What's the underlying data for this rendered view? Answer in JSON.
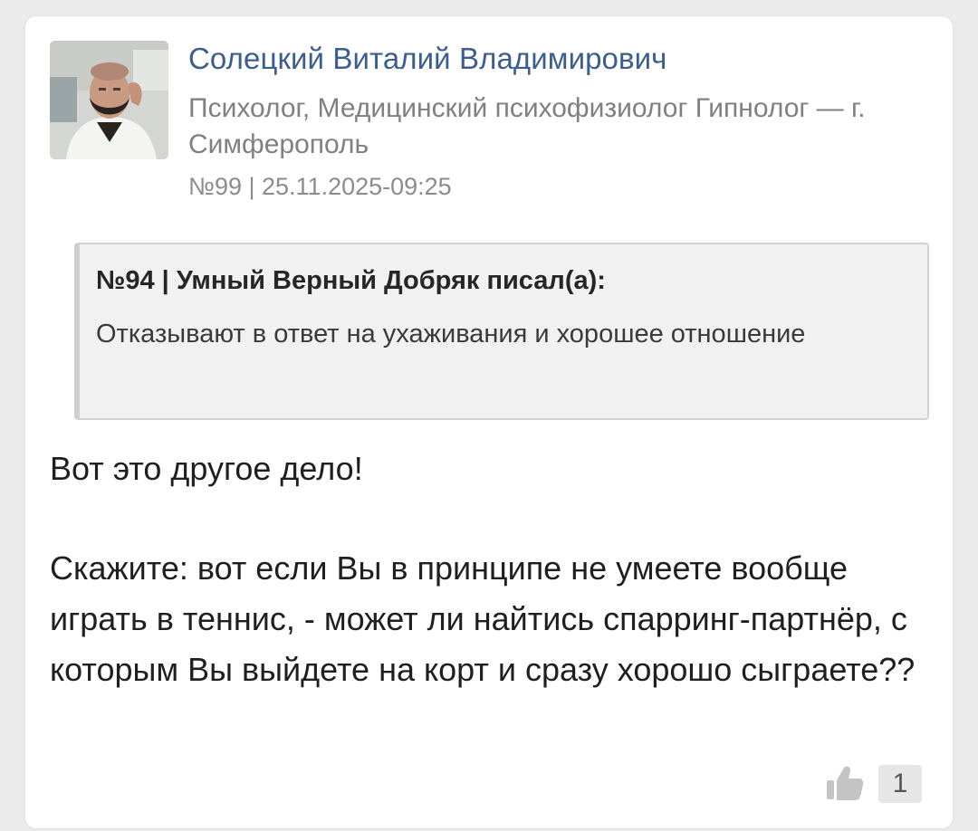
{
  "author": {
    "name": "Солецкий Виталий Владимирович",
    "title": "Психолог, Медицинский психофизиолог Гипнолог — г. Симферополь",
    "post_meta": "№99 | 25.11.2025-09:25"
  },
  "quote": {
    "header": "№94 | Умный Верный Добряк писал(а):",
    "text": "Отказывают в ответ на ухаживания и хорошее отношение"
  },
  "post": {
    "paragraph1": "Вот это другое дело!",
    "paragraph2": "Скажите: вот если Вы в принципе не умеете вообще играть в теннис, - может ли найтись спарринг-партнёр, с которым Вы выйдете на корт и сразу хорошо сыграете??"
  },
  "likes": {
    "icon": "thumbs-up-icon",
    "count": "1"
  },
  "colors": {
    "author_name": "#3b5d8f",
    "page_background": "#ebebeb",
    "quote_background": "#f1f1f1"
  }
}
